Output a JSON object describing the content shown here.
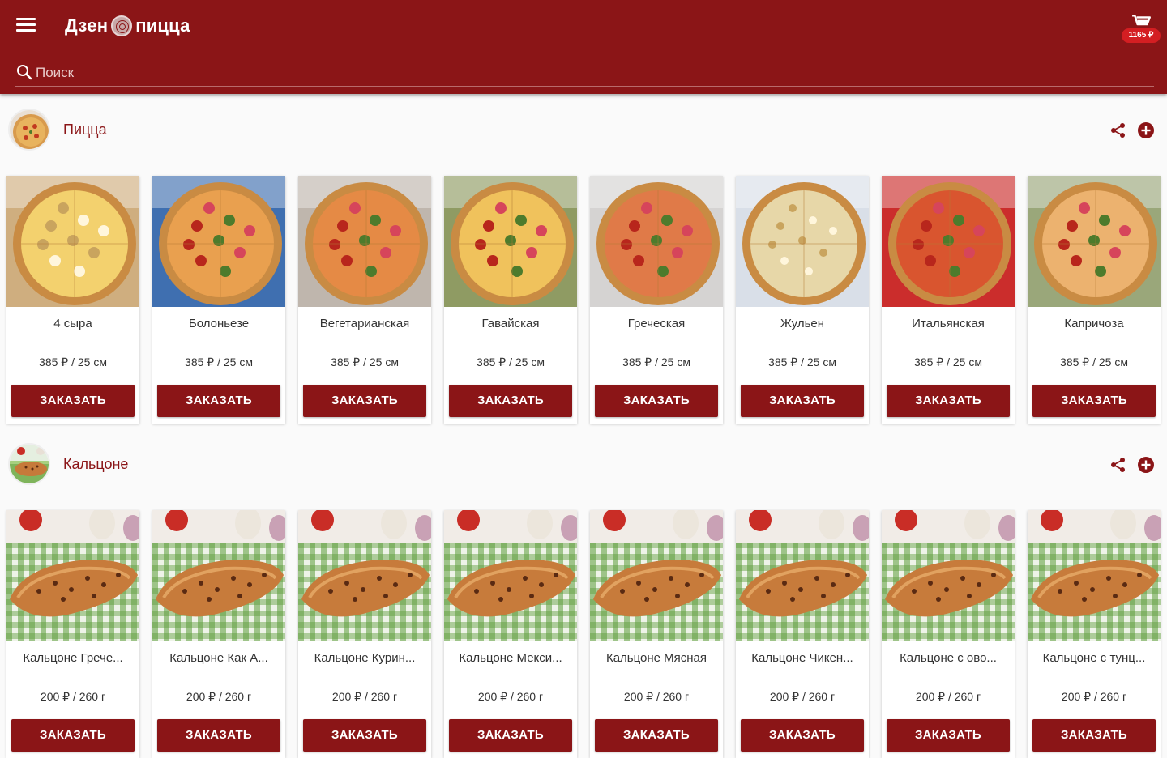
{
  "brand": {
    "name_left": "Дзен",
    "name_right": "пицца",
    "accent": "#8b1517"
  },
  "header": {
    "menu_icon": "menu-icon",
    "cart_icon": "cart-icon",
    "cart_total": "1165 ₽"
  },
  "search": {
    "placeholder": "Поиск",
    "icon": "search-icon"
  },
  "categories": [
    {
      "title": "Пицца",
      "share_icon": "share-icon",
      "add_icon": "add-circle-icon",
      "items": [
        {
          "name": "4 сыра",
          "price": "385 ₽ / 25 см",
          "button": "ЗАКАЗАТЬ"
        },
        {
          "name": "Болоньезе",
          "price": "385 ₽ / 25 см",
          "button": "ЗАКАЗАТЬ"
        },
        {
          "name": "Вегетарианская",
          "price": "385 ₽ / 25 см",
          "button": "ЗАКАЗАТЬ"
        },
        {
          "name": "Гавайская",
          "price": "385 ₽ / 25 см",
          "button": "ЗАКАЗАТЬ"
        },
        {
          "name": "Греческая",
          "price": "385 ₽ / 25 см",
          "button": "ЗАКАЗАТЬ"
        },
        {
          "name": "Жульен",
          "price": "385 ₽ / 25 см",
          "button": "ЗАКАЗАТЬ"
        },
        {
          "name": "Итальянская",
          "price": "385 ₽ / 25 см",
          "button": "ЗАКАЗАТЬ"
        },
        {
          "name": "Капричоза",
          "price": "385 ₽ / 25 см",
          "button": "ЗАКАЗАТЬ"
        }
      ]
    },
    {
      "title": "Кальцоне",
      "share_icon": "share-icon",
      "add_icon": "add-circle-icon",
      "items": [
        {
          "name": "Кальцоне Грече...",
          "price": "200 ₽ / 260 г",
          "button": "ЗАКАЗАТЬ"
        },
        {
          "name": "Кальцоне Как А...",
          "price": "200 ₽ / 260 г",
          "button": "ЗАКАЗАТЬ"
        },
        {
          "name": "Кальцоне Курин...",
          "price": "200 ₽ / 260 г",
          "button": "ЗАКАЗАТЬ"
        },
        {
          "name": "Кальцоне Мекси...",
          "price": "200 ₽ / 260 г",
          "button": "ЗАКАЗАТЬ"
        },
        {
          "name": "Кальцоне Мясная",
          "price": "200 ₽ / 260 г",
          "button": "ЗАКАЗАТЬ"
        },
        {
          "name": "Кальцоне Чикен...",
          "price": "200 ₽ / 260 г",
          "button": "ЗАКАЗАТЬ"
        },
        {
          "name": "Кальцоне с ово...",
          "price": "200 ₽ / 260 г",
          "button": "ЗАКАЗАТЬ"
        },
        {
          "name": "Кальцоне с тунц...",
          "price": "200 ₽ / 260 г",
          "button": "ЗАКАЗАТЬ"
        }
      ]
    }
  ]
}
